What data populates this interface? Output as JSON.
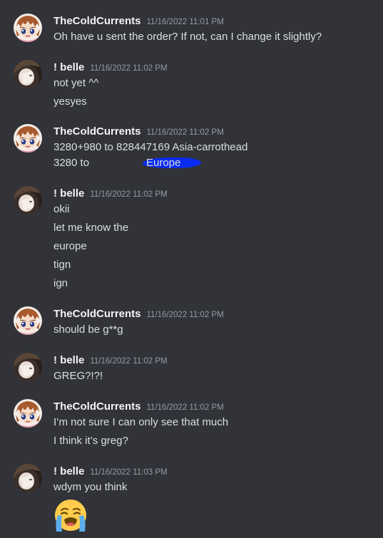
{
  "colors": {
    "background": "#313338",
    "username": "#f2f3f5",
    "timestamp": "#949ba4",
    "text": "#dbdee1",
    "redaction": "#0a2bf0"
  },
  "messages": [
    {
      "author": "TheColdCurrents",
      "timestamp": "11/16/2022 11:01 PM",
      "avatar": "anime-avatar-icon",
      "lines": [
        "Oh have u sent the order? If not, can I change it slightly?"
      ]
    },
    {
      "author": "! belle",
      "timestamp": "11/16/2022 11:02 PM",
      "avatar": "photo-avatar-icon",
      "lines": [
        "not yet ^^",
        "yesyes"
      ]
    },
    {
      "author": "TheColdCurrents",
      "timestamp": "11/16/2022 11:02 PM",
      "avatar": "anime-avatar-icon",
      "lines": [
        "3280+980 to 828447169 Asia-carrothead",
        "3280 to",
        "Europe"
      ]
    },
    {
      "author": "! belle",
      "timestamp": "11/16/2022 11:02 PM",
      "avatar": "photo-avatar-icon",
      "lines": [
        "okii",
        "let me know the",
        "europe",
        "tign",
        "ign"
      ]
    },
    {
      "author": "TheColdCurrents",
      "timestamp": "11/16/2022 11:02 PM",
      "avatar": "anime-avatar-icon",
      "lines": [
        "should be g**g"
      ]
    },
    {
      "author": "! belle",
      "timestamp": "11/16/2022 11:02 PM",
      "avatar": "photo-avatar-icon",
      "lines": [
        "GREG?!?!"
      ]
    },
    {
      "author": "TheColdCurrents",
      "timestamp": "11/16/2022 11:02 PM",
      "avatar": "anime-avatar-icon",
      "lines": [
        "I’m not sure I can only see that much",
        "I think it’s greg?"
      ]
    },
    {
      "author": "! belle",
      "timestamp": "11/16/2022 11:03 PM",
      "avatar": "photo-avatar-icon",
      "lines": [
        "wdym you think"
      ],
      "emoji": "loudly-crying-face-icon"
    }
  ]
}
